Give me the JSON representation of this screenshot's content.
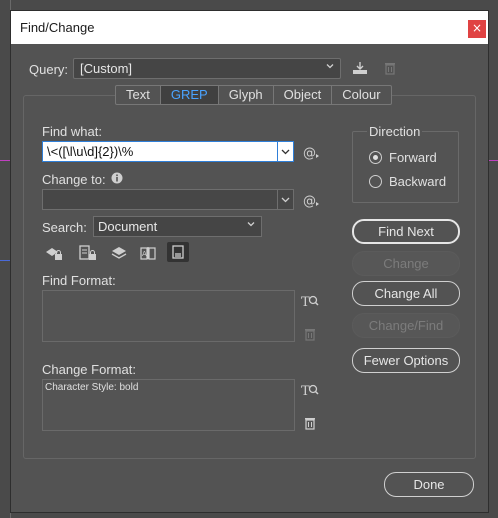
{
  "window": {
    "title": "Find/Change",
    "close_glyph": "×"
  },
  "query": {
    "label": "Query:",
    "value": "[Custom]"
  },
  "tabs": [
    {
      "label": "Text",
      "active": false
    },
    {
      "label": "GREP",
      "active": true
    },
    {
      "label": "Glyph",
      "active": false
    },
    {
      "label": "Object",
      "active": false
    },
    {
      "label": "Colour",
      "active": false
    }
  ],
  "find_what": {
    "label": "Find what:",
    "value": "\\<([\\l\\u\\d]{2})\\%"
  },
  "change_to": {
    "label": "Change to:",
    "value": ""
  },
  "search": {
    "label": "Search:",
    "value": "Document"
  },
  "find_format": {
    "label": "Find Format:",
    "value": ""
  },
  "change_format": {
    "label": "Change Format:",
    "value": "Character Style: bold"
  },
  "direction": {
    "label": "Direction",
    "options": [
      {
        "label": "Forward",
        "selected": true
      },
      {
        "label": "Backward",
        "selected": false
      }
    ]
  },
  "buttons": {
    "find_next": "Find Next",
    "change": "Change",
    "change_all": "Change All",
    "change_find": "Change/Find",
    "fewer_options": "Fewer Options",
    "done": "Done"
  },
  "icons": {
    "save_query": "save-query-icon",
    "delete_query": "trash-icon",
    "special_chars": "at-sign-icon",
    "info": "info-icon",
    "format_search": "format-search-icon"
  },
  "colors": {
    "accent": "#4aa3ff",
    "close": "#e04343"
  }
}
